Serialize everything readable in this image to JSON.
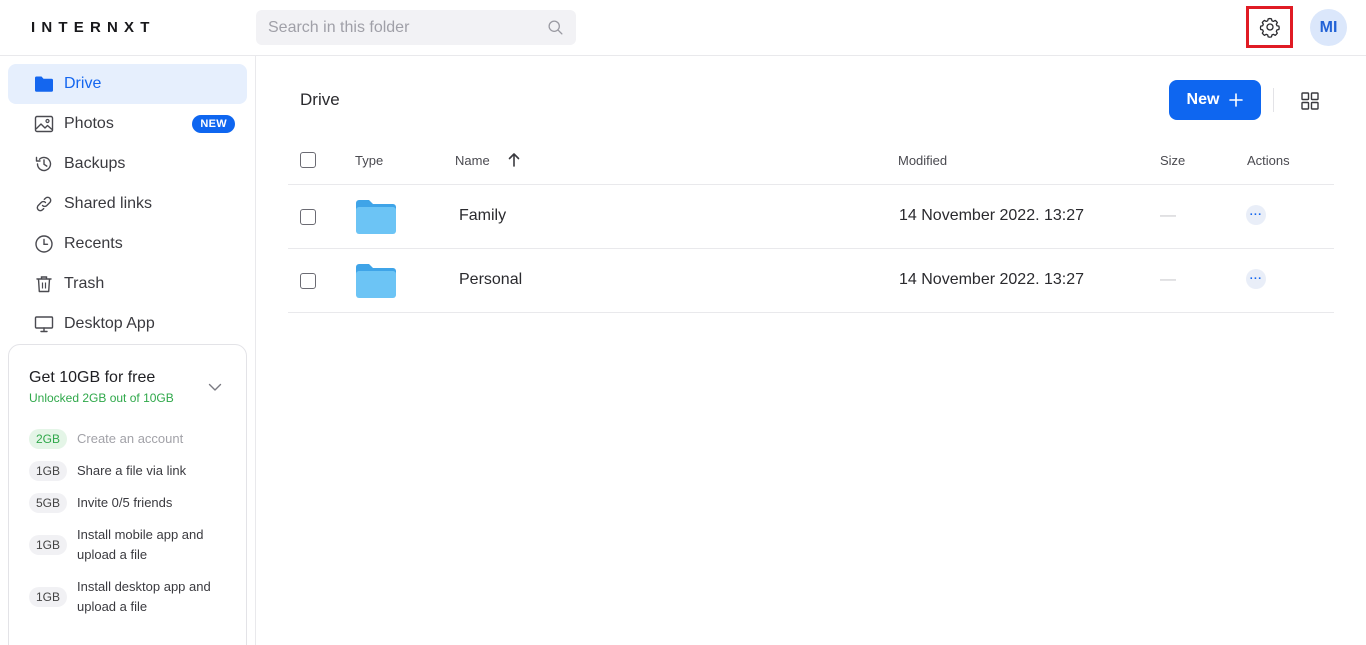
{
  "app": {
    "logo": "INTERNXT"
  },
  "search": {
    "placeholder": "Search in this folder"
  },
  "user": {
    "initials": "MI"
  },
  "colors": {
    "accent": "#0e66f0",
    "active_bg": "#e6effd",
    "promo_green": "#2fa84a",
    "highlight_border": "#e01b24",
    "folder_blue": "#5ebaf2"
  },
  "sidebar": {
    "items": [
      {
        "label": "Drive",
        "icon": "folder-icon",
        "active": true
      },
      {
        "label": "Photos",
        "icon": "image-icon",
        "badge": "NEW"
      },
      {
        "label": "Backups",
        "icon": "history-icon"
      },
      {
        "label": "Shared links",
        "icon": "link-icon"
      },
      {
        "label": "Recents",
        "icon": "clock-icon"
      },
      {
        "label": "Trash",
        "icon": "trash-icon"
      },
      {
        "label": "Desktop App",
        "icon": "desktop-icon"
      }
    ],
    "promo": {
      "title": "Get 10GB for free",
      "subtitle": "Unlocked 2GB out of 10GB",
      "tasks": [
        {
          "size": "2GB",
          "text": "Create an account",
          "done": true
        },
        {
          "size": "1GB",
          "text": "Share a file via link",
          "done": false
        },
        {
          "size": "5GB",
          "text": "Invite 0/5 friends",
          "done": false
        },
        {
          "size": "1GB",
          "text": "Install mobile app and upload a file",
          "done": false
        },
        {
          "size": "1GB",
          "text": "Install desktop app and upload a file",
          "done": false
        }
      ]
    }
  },
  "main": {
    "breadcrumb": "Drive",
    "new_button": "New",
    "table": {
      "headers": {
        "type": "Type",
        "name": "Name",
        "modified": "Modified",
        "size": "Size",
        "actions": "Actions"
      },
      "rows": [
        {
          "name": "Family",
          "modified": "14 November 2022. 13:27",
          "size": "—",
          "actions": "···"
        },
        {
          "name": "Personal",
          "modified": "14 November 2022. 13:27",
          "size": "—",
          "actions": "···"
        }
      ]
    }
  }
}
